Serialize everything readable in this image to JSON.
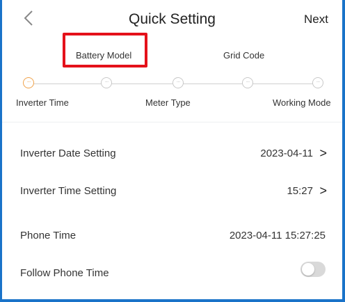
{
  "header": {
    "title": "Quick Setting",
    "next_label": "Next"
  },
  "steps": {
    "top_labels": [
      "Battery Model",
      "Grid Code"
    ],
    "bottom_labels": [
      "Inverter Time",
      "Meter Type",
      "Working Mode"
    ],
    "active_index": 0,
    "highlighted_label": "Battery Model"
  },
  "settings": {
    "inverter_date": {
      "label": "Inverter Date Setting",
      "value": "2023-04-11"
    },
    "inverter_time": {
      "label": "Inverter Time Setting",
      "value": "15:27"
    },
    "phone_time": {
      "label": "Phone Time",
      "value": "2023-04-11 15:27:25"
    },
    "follow_phone_time": {
      "label": "Follow Phone Time",
      "enabled": false
    }
  },
  "colors": {
    "frame": "#1a73c9",
    "highlight": "#e4111a",
    "active_step": "#f0a24a",
    "inactive_step": "#c8c8c8"
  }
}
